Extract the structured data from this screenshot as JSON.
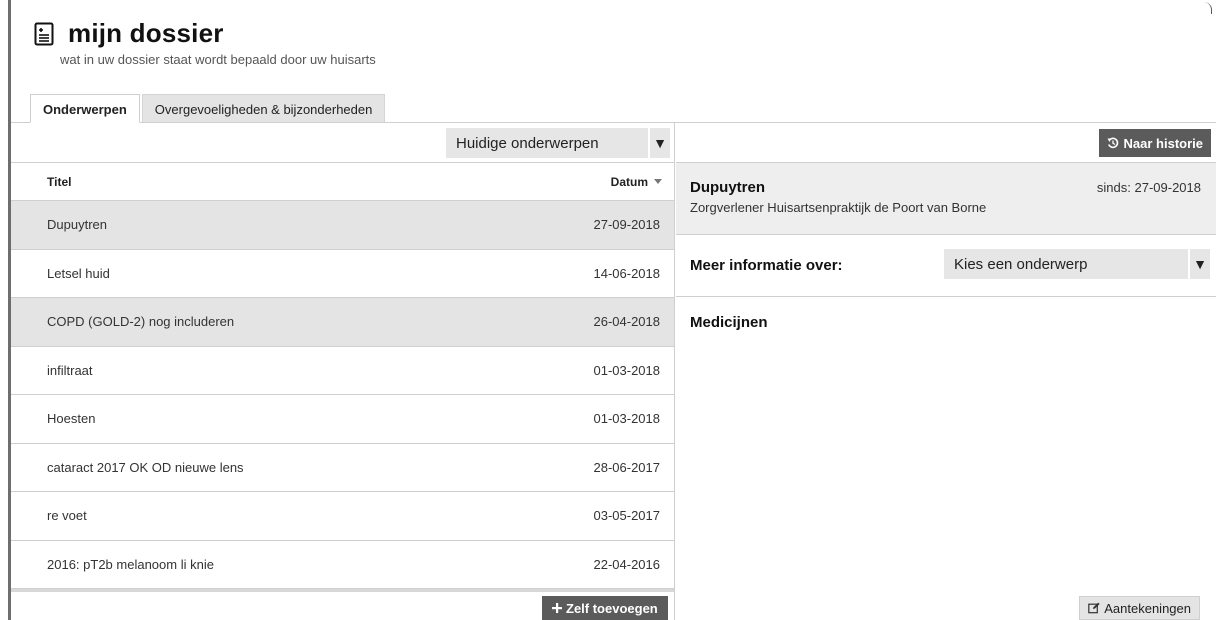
{
  "header": {
    "title": "mijn dossier",
    "subtitle": "wat in uw dossier staat wordt bepaald door uw huisarts",
    "icon": "document-list-icon"
  },
  "tabs": [
    {
      "label": "Onderwerpen",
      "active": true
    },
    {
      "label": "Overgevoeligheden & bijzonderheden",
      "active": false
    }
  ],
  "filter": {
    "selected": "Huidige onderwerpen",
    "arrow": "▼"
  },
  "table": {
    "col_title": "Titel",
    "col_date": "Datum",
    "rows": [
      {
        "title": "Dupuytren",
        "date": "27-09-2018",
        "selected": true
      },
      {
        "title": "Letsel huid",
        "date": "14-06-2018",
        "selected": false
      },
      {
        "title": "COPD (GOLD-2) nog includeren",
        "date": "26-04-2018",
        "selected": false
      },
      {
        "title": "infiltraat",
        "date": "01-03-2018",
        "selected": false
      },
      {
        "title": "Hoesten",
        "date": "01-03-2018",
        "selected": false
      },
      {
        "title": "cataract 2017 OK OD nieuwe lens",
        "date": "28-06-2017",
        "selected": false
      },
      {
        "title": "re voet",
        "date": "03-05-2017",
        "selected": false
      },
      {
        "title": "2016: pT2b melanoom li knie",
        "date": "22-04-2016",
        "selected": false
      }
    ]
  },
  "add_button": {
    "label": "Zelf toevoegen",
    "icon": "plus-icon"
  },
  "history_button": {
    "label": "Naar historie",
    "icon": "history-icon"
  },
  "detail": {
    "name": "Dupuytren",
    "since": "sinds: 27-09-2018",
    "provider": "Zorgverlener Huisartsenpraktijk de Poort van Borne"
  },
  "more_info": {
    "label": "Meer informatie over:",
    "select_value": "Kies een onderwerp",
    "arrow": "▼"
  },
  "medicines": {
    "title": "Medicijnen"
  },
  "notes_button": {
    "label": "Aantekeningen",
    "icon": "edit-icon"
  },
  "colors": {
    "selected_row": "#e4e4e4",
    "dark_button": "#5b5b5b",
    "border": "#cfcfcf"
  }
}
